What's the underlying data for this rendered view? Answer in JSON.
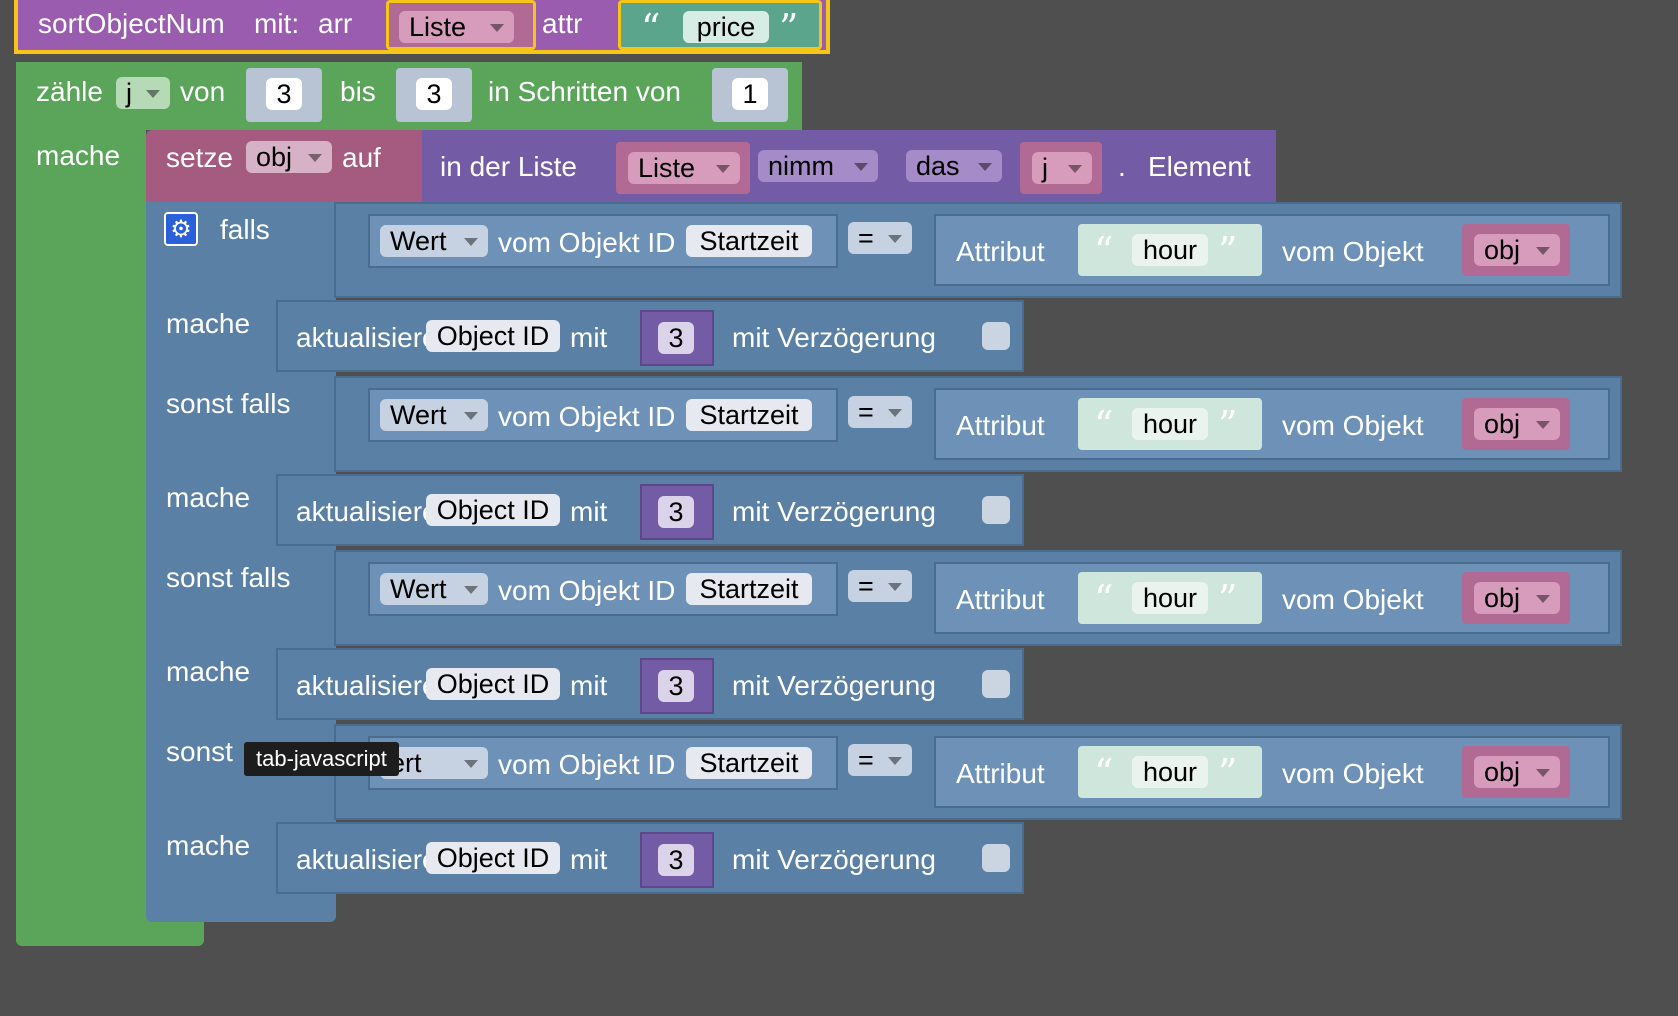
{
  "procedure": {
    "name": "sortObjectNum",
    "with_label": "mit:",
    "param1": "arr",
    "param1_value": "Liste",
    "param2": "attr",
    "param2_value": "price"
  },
  "loop": {
    "label": "zähle",
    "var": "j",
    "from_label": "von",
    "from": "3",
    "to_label": "bis",
    "to": "3",
    "step_label": "in Schritten von",
    "step": "1",
    "do_label": "mache"
  },
  "set_block": {
    "label": "setze",
    "var": "obj",
    "to_label": "auf",
    "list_label": "in der Liste",
    "list_var": "Liste",
    "op": "nimm",
    "mode": "das",
    "index": "j",
    "dot": ".",
    "element_label": "Element"
  },
  "if_block": {
    "if_label": "falls",
    "elseif_label": "sonst falls",
    "else_label": "sonst",
    "do_label": "mache",
    "conditions": [
      {
        "value_dd": "Wert",
        "from_obj": "vom Objekt ID",
        "obj_id": "Startzeit",
        "op": "=",
        "attr_label": "Attribut",
        "attr": "hour",
        "of_obj": "vom Objekt",
        "obj_var": "obj"
      },
      {
        "value_dd": "Wert",
        "from_obj": "vom Objekt ID",
        "obj_id": "Startzeit",
        "op": "=",
        "attr_label": "Attribut",
        "attr": "hour",
        "of_obj": "vom Objekt",
        "obj_var": "obj"
      },
      {
        "value_dd": "Wert",
        "from_obj": "vom Objekt ID",
        "obj_id": "Startzeit",
        "op": "=",
        "attr_label": "Attribut",
        "attr": "hour",
        "of_obj": "vom Objekt",
        "obj_var": "obj"
      },
      {
        "value_dd": "ert",
        "from_obj": "vom Objekt ID",
        "obj_id": "Startzeit",
        "op": "=",
        "attr_label": "Attribut",
        "attr": "hour",
        "of_obj": "vom Objekt",
        "obj_var": "obj"
      }
    ],
    "actions": [
      {
        "label": "aktualisiere",
        "obj_id": "Object ID",
        "with": "mit",
        "value": "3",
        "delay_label": "mit Verzögerung"
      },
      {
        "label": "aktualisiere",
        "obj_id": "Object ID",
        "with": "mit",
        "value": "3",
        "delay_label": "mit Verzögerung"
      },
      {
        "label": "aktualisiere",
        "obj_id": "Object ID",
        "with": "mit",
        "value": "3",
        "delay_label": "mit Verzögerung"
      },
      {
        "label": "aktualisiere",
        "obj_id": "Object ID",
        "with": "mit",
        "value": "3",
        "delay_label": "mit Verzögerung"
      }
    ]
  },
  "tooltip": "tab-javascript",
  "icons": {
    "gear": "gear-icon",
    "dropdown": "chevron-down-icon"
  },
  "colors": {
    "procedure": "#9a5cae",
    "loop": "#5ba55b",
    "set": "#a55b80",
    "list": "#745ba5",
    "logic": "#5b80a5",
    "text": "#5ba58c",
    "selected_border": "#f5c518",
    "workspace": "#4f4f4f"
  }
}
